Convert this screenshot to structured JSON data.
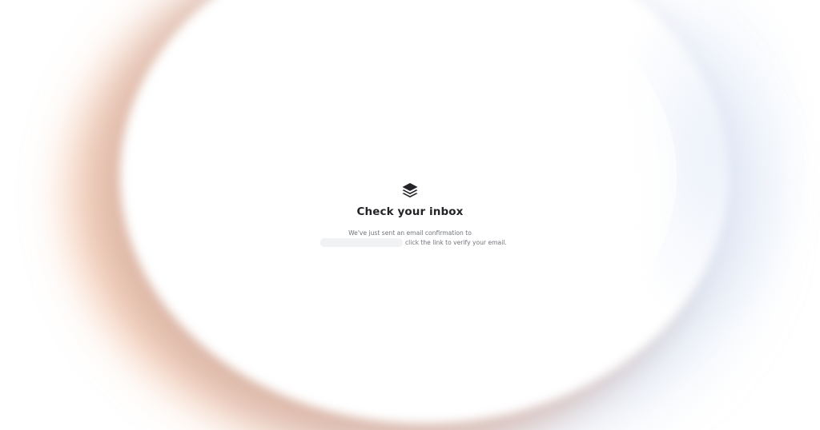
{
  "background": {
    "accent_warm": "#f2a678",
    "accent_cool": "#96aacd"
  },
  "logo": {
    "icon": "stack-layers-icon",
    "color": "#222427"
  },
  "heading": {
    "title": "Check your inbox"
  },
  "message": {
    "line1": "We've just sent an email confirmation to",
    "email": "",
    "line2_suffix": "click the link to verify your email."
  }
}
